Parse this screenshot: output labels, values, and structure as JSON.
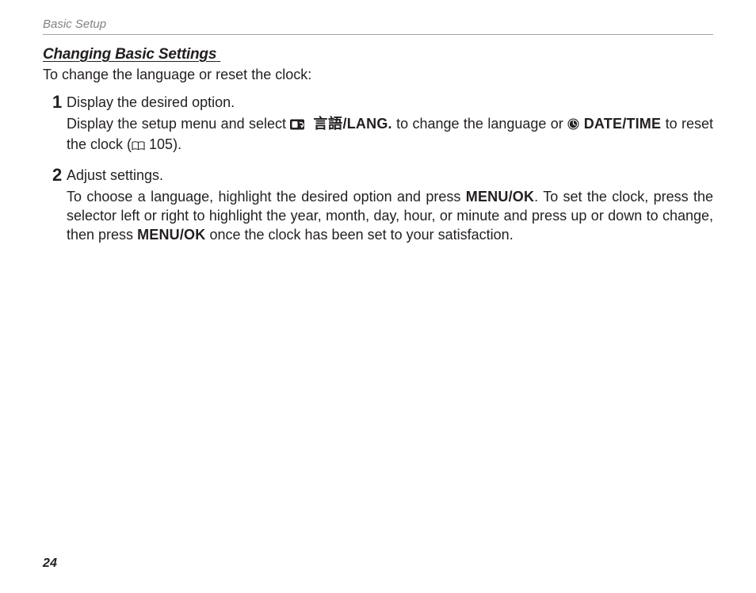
{
  "header": {
    "running_head": "Basic Setup"
  },
  "section": {
    "heading": "Changing Basic Settings",
    "intro": "To change the language or reset the clock:"
  },
  "steps": [
    {
      "title": "Display the desired option.",
      "body_pre": "Display the setup menu and select ",
      "lang_label": "言語/LANG.",
      "body_mid": " to change the language or ",
      "date_label": "DATE/TIME",
      "body_after_date": " to reset the clock (",
      "page_ref": " 105",
      "body_suffix": ")."
    },
    {
      "title": "Adjust settings.",
      "body_a": "To choose a language, highlight the desired option and press ",
      "menuok1": "MENU/OK",
      "body_b": ".  To set the clock, press the selector left or right to highlight the year, month, day, hour, or minute and press up or down to change, then press ",
      "menuok2": "MENU/OK",
      "body_c": " once the clock has been set to your satisfaction."
    }
  ],
  "page_number": "24"
}
